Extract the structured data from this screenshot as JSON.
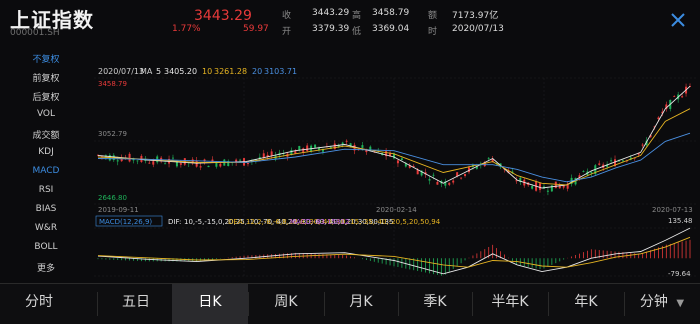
{
  "header": {
    "title": "上证指数",
    "code": "000001.SH",
    "price": "3443.29",
    "change_pct": "1.77%",
    "change": "59.97",
    "quote": {
      "shou_label": "收",
      "shou": "3443.29",
      "gao_label": "高",
      "gao": "3458.79",
      "e_label": "额",
      "e": "7173.97亿",
      "kai_label": "开",
      "kai": "3379.39",
      "di_label": "低",
      "di": "3369.04",
      "shi_label": "时",
      "shi": "2020/07/13"
    },
    "close_icon": "close-x-icon"
  },
  "sidebar": {
    "items": [
      {
        "label": "不复权",
        "active": true
      },
      {
        "label": "前复权",
        "active": false
      },
      {
        "label": "后复权",
        "active": false
      },
      {
        "label": "VOL",
        "active": false
      },
      {
        "label": "成交额",
        "active": false
      },
      {
        "label": "KDJ",
        "active": false
      },
      {
        "label": "MACD",
        "active": true
      },
      {
        "label": "RSI",
        "active": false
      },
      {
        "label": "BIAS",
        "active": false
      },
      {
        "label": "W&R",
        "active": false
      },
      {
        "label": "BOLL",
        "active": false
      },
      {
        "label": "更多",
        "active": false
      }
    ]
  },
  "chart_data": {
    "type": "line",
    "ma_legend": {
      "date": "2020/07/13",
      "ma": "MA",
      "ma5_label": "5",
      "ma5": "3405.20",
      "ma10_label": "10",
      "ma10": "3261.28",
      "ma20_label": "20",
      "ma20": "3103.71"
    },
    "price_labels": {
      "max": "3458.79",
      "mid": "3052.79",
      "min": "2646.80"
    },
    "x_labels": [
      "2019-09-11",
      "2020-02-14",
      "2020-07-13"
    ],
    "ylim": [
      2646.8,
      3458.79
    ],
    "series": [
      {
        "name": "MA5",
        "color": "#e8e8e8",
        "x": [
          0,
          20,
          40,
          60,
          80,
          100,
          120,
          140,
          160,
          170,
          180,
          190,
          200,
          210,
          220,
          230,
          240
        ],
        "values": [
          2960,
          2930,
          2910,
          2920,
          2990,
          3030,
          2950,
          2780,
          2940,
          2800,
          2750,
          2770,
          2860,
          2920,
          2980,
          3260,
          3405
        ]
      },
      {
        "name": "MA10",
        "color": "#e6b422",
        "x": [
          0,
          20,
          40,
          60,
          80,
          100,
          120,
          140,
          160,
          170,
          180,
          190,
          200,
          210,
          220,
          230,
          240
        ],
        "values": [
          2950,
          2935,
          2915,
          2915,
          2970,
          3020,
          2970,
          2850,
          2920,
          2830,
          2780,
          2770,
          2840,
          2900,
          2960,
          3180,
          3261
        ]
      },
      {
        "name": "MA20",
        "color": "#4a8fe0",
        "x": [
          0,
          20,
          40,
          60,
          80,
          100,
          120,
          140,
          160,
          170,
          180,
          190,
          200,
          210,
          220,
          230,
          240
        ],
        "values": [
          2940,
          2935,
          2925,
          2915,
          2950,
          3000,
          2990,
          2900,
          2900,
          2870,
          2820,
          2790,
          2820,
          2880,
          2930,
          3050,
          3103
        ]
      }
    ],
    "macd": {
      "legend": "MACD(12,26,9)",
      "dif_label": "DIF:",
      "dif": [
        10,
        -5,
        -15,
        0,
        20,
        25,
        -10,
        -70,
        -40,
        20,
        -30,
        -60,
        -40,
        0,
        20,
        30,
        80,
        135
      ],
      "dea_label": "DEA:",
      "dea": [
        12,
        2,
        -8,
        -6,
        8,
        18,
        8,
        -30,
        -40,
        -10,
        -15,
        -35,
        -40,
        -20,
        5,
        20,
        50,
        94
      ],
      "macd_label": "MACD:",
      "macd_val": "83.15812",
      "max": "135.48",
      "min": "-79.64",
      "ylim": [
        -79.64,
        135.48
      ],
      "x": [
        0,
        20,
        40,
        60,
        80,
        100,
        120,
        140,
        150,
        160,
        170,
        180,
        190,
        200,
        210,
        220,
        230,
        240
      ]
    }
  },
  "tabs": [
    {
      "label": "分时",
      "active": false
    },
    {
      "label": "五日",
      "active": false
    },
    {
      "label": "日K",
      "active": true
    },
    {
      "label": "周K",
      "active": false
    },
    {
      "label": "月K",
      "active": false
    },
    {
      "label": "季K",
      "active": false
    },
    {
      "label": "半年K",
      "active": false
    },
    {
      "label": "年K",
      "active": false
    },
    {
      "label": "分钟",
      "active": false
    }
  ],
  "colors": {
    "up": "#e83a3a",
    "down": "#1fb25a",
    "accent": "#3c8ce0"
  }
}
